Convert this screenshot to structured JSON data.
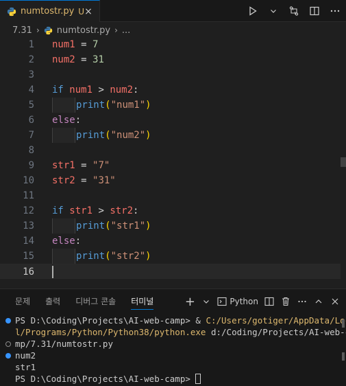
{
  "tab": {
    "filename": "numtostr.py",
    "badge": "U",
    "close": "×"
  },
  "breadcrumb": {
    "folder": "7.31",
    "file": "numtostr.py",
    "more": "..."
  },
  "editor": {
    "current_line": 16,
    "lines": [
      {
        "n": "1"
      },
      {
        "n": "2"
      },
      {
        "n": "3"
      },
      {
        "n": "4"
      },
      {
        "n": "5"
      },
      {
        "n": "6"
      },
      {
        "n": "7"
      },
      {
        "n": "8"
      },
      {
        "n": "9"
      },
      {
        "n": "10"
      },
      {
        "n": "11"
      },
      {
        "n": "12"
      },
      {
        "n": "13"
      },
      {
        "n": "14"
      },
      {
        "n": "15"
      },
      {
        "n": "16"
      }
    ],
    "tokens": {
      "l1_var": "num1",
      "l1_op": " = ",
      "l1_val": "7",
      "l2_var": "num2",
      "l2_op": " = ",
      "l2_val": "31",
      "l4_kw": "if",
      "l4_a": "num1",
      "l4_op": " > ",
      "l4_b": "num2",
      "l4_colon": ":",
      "l5_fn": "print",
      "l5_open": "(",
      "l5_str": "\"num1\"",
      "l5_close": ")",
      "l6_kw": "else",
      "l6_colon": ":",
      "l7_fn": "print",
      "l7_open": "(",
      "l7_str": "\"num2\"",
      "l7_close": ")",
      "l9_var": "str1",
      "l9_op": " = ",
      "l9_val": "\"7\"",
      "l10_var": "str2",
      "l10_op": " = ",
      "l10_val": "\"31\"",
      "l12_kw": "if",
      "l12_a": "str1",
      "l12_op": " > ",
      "l12_b": "str2",
      "l12_colon": ":",
      "l13_fn": "print",
      "l13_open": "(",
      "l13_str": "\"str1\"",
      "l13_close": ")",
      "l14_kw": "else",
      "l14_colon": ":",
      "l15_fn": "print",
      "l15_open": "(",
      "l15_str": "\"str2\"",
      "l15_close": ")"
    }
  },
  "panel": {
    "tabs": [
      {
        "label": "문제"
      },
      {
        "label": "출력"
      },
      {
        "label": "디버그 콘솔"
      },
      {
        "label": "터미널"
      }
    ],
    "active_tab": "터미널",
    "terminal_name": "Python",
    "add": "+",
    "chevron": "∨"
  },
  "terminal": {
    "line1_prefix": "PS D:\\Coding\\Projects\\AI-web-camp> & ",
    "line1_path": "C:/Users/gotiger/AppData/Loca",
    "line2_path": "l/Programs/Python/Python38/python.exe",
    "line2_rest": " d:/Coding/Projects/AI-web-ca",
    "line3": "mp/7.31/numtostr.py",
    "out1": "num2",
    "out2": "str1",
    "prompt": "PS D:\\Coding\\Projects\\AI-web-camp> "
  },
  "colors": {
    "accent": "#0078d4",
    "modified": "#ddb86e",
    "keyword": "#c586c0",
    "function": "#569cd6",
    "string": "#ce9178",
    "number": "#b5cea8",
    "variable": "#f47067"
  }
}
